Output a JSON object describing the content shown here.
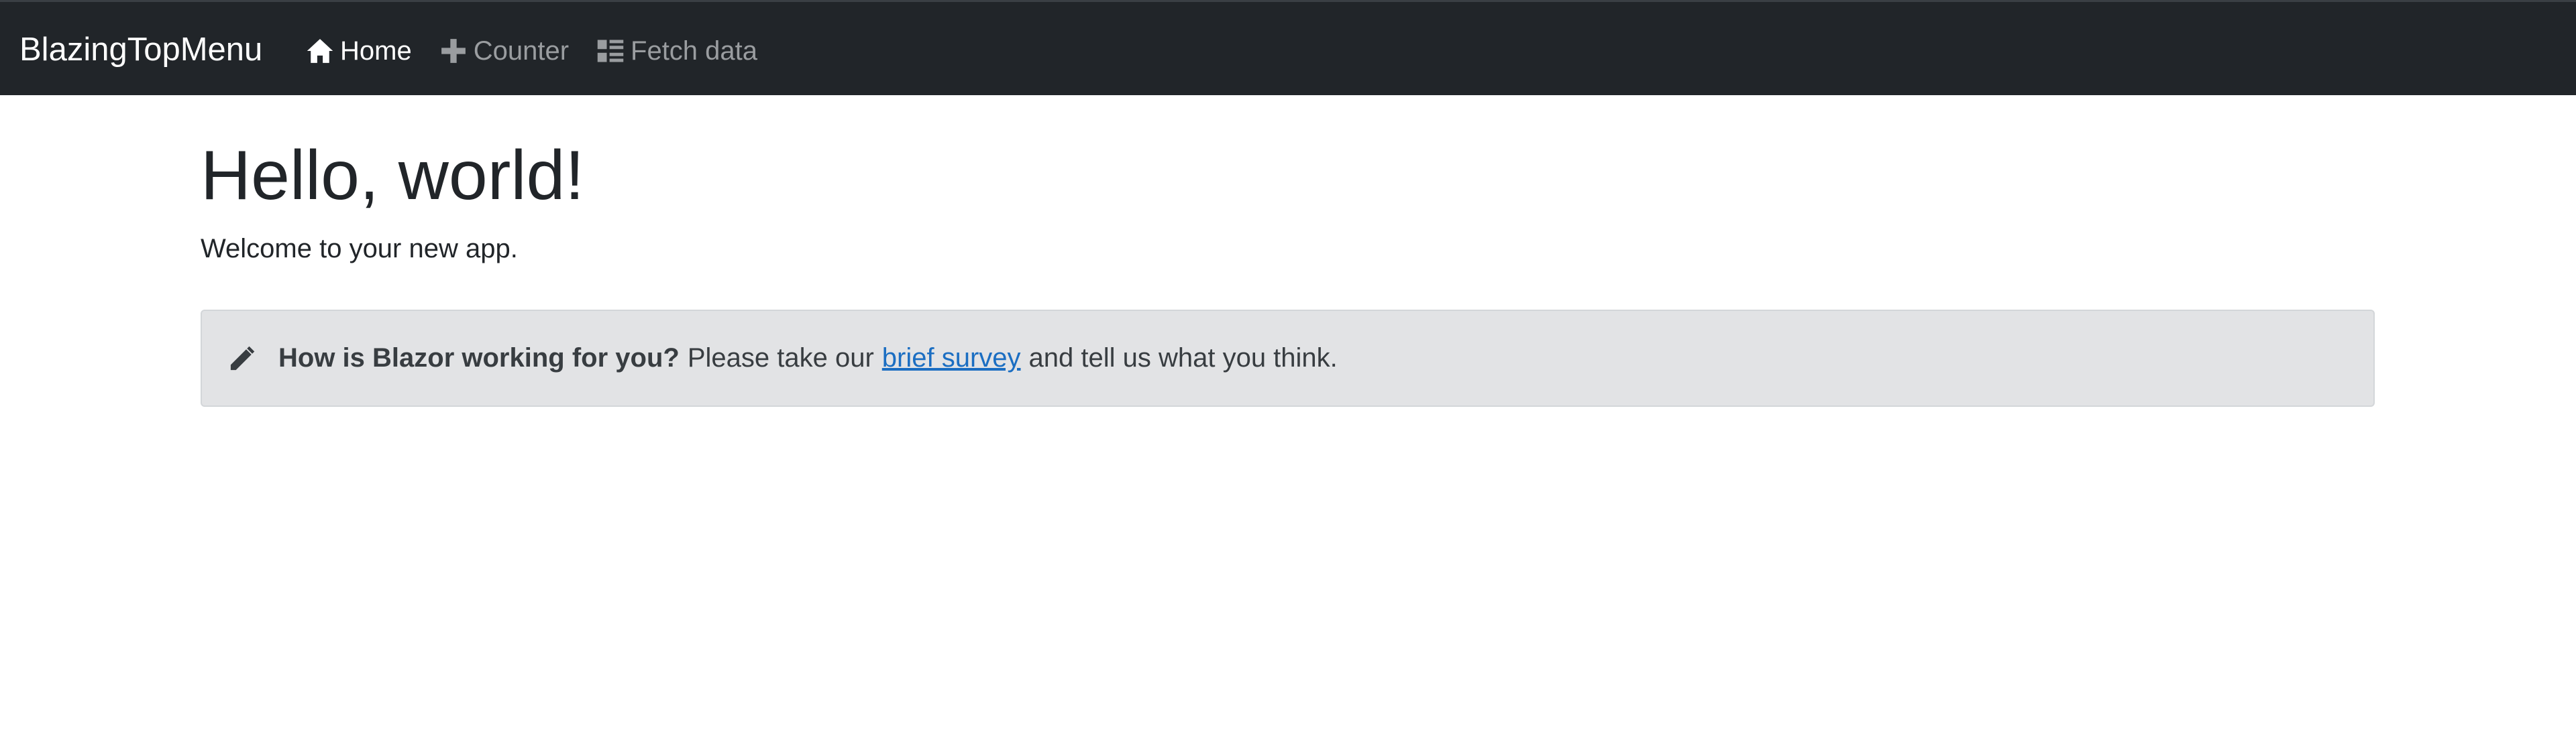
{
  "navbar": {
    "brand": "BlazingTopMenu",
    "items": [
      {
        "label": "Home",
        "icon": "home-icon",
        "active": true
      },
      {
        "label": "Counter",
        "icon": "plus-icon",
        "active": false
      },
      {
        "label": "Fetch data",
        "icon": "list-icon",
        "active": false
      }
    ]
  },
  "main": {
    "title": "Hello, world!",
    "welcome": "Welcome to your new app."
  },
  "survey": {
    "icon": "pencil-icon",
    "question": "How is Blazor working for you?",
    "text_before": "Please take our",
    "link_text": "brief survey",
    "text_after": "and tell us what you think."
  },
  "colors": {
    "navbar_bg": "#212529",
    "link": "#1b6ec2",
    "alert_bg": "#e2e3e5"
  }
}
